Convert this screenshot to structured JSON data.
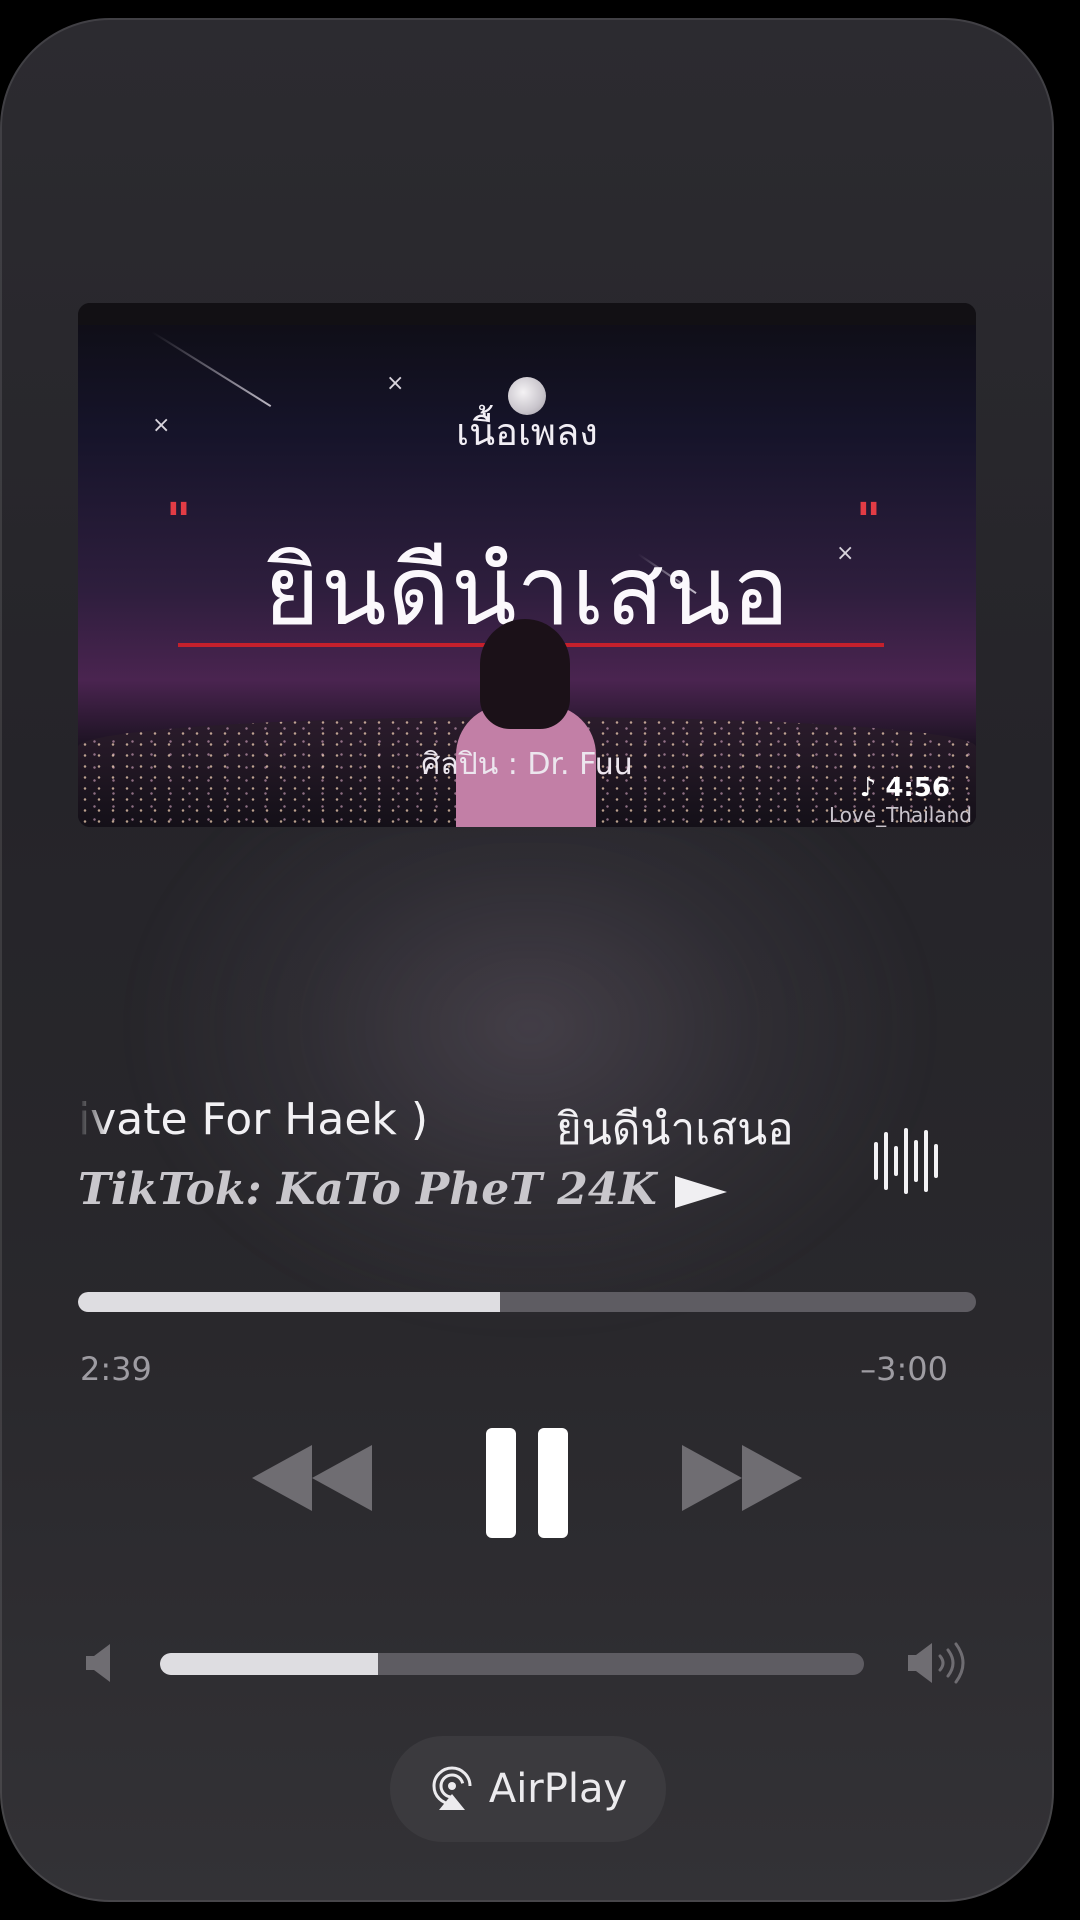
{
  "artwork": {
    "lyric_heading": "เนื้อเพลง",
    "title": "ยินดีนำเสนอ",
    "artist_line": "ศิลปิน : Dr. Fuu",
    "duration": "♪ 4:56",
    "watermark": "Love_Thailand",
    "quote_left": "\"",
    "quote_right": "\""
  },
  "now_playing": {
    "title_part_a": "ivate For Haek )",
    "title_part_b": "ยินดีนำเสนอ",
    "artist": "TikTok: KaTo PheT 24K"
  },
  "progress": {
    "elapsed": "2:39",
    "remaining": "–3:00",
    "fraction": 0.47
  },
  "volume": {
    "fraction": 0.31
  },
  "airplay": {
    "label": "AirPlay"
  },
  "icons": {
    "rewind": "rewind-icon",
    "pause": "pause-icon",
    "forward": "fast-forward-icon",
    "volume_low": "speaker-low-icon",
    "volume_high": "speaker-high-icon",
    "airplay": "airplay-icon",
    "waveform": "waveform-icon"
  }
}
